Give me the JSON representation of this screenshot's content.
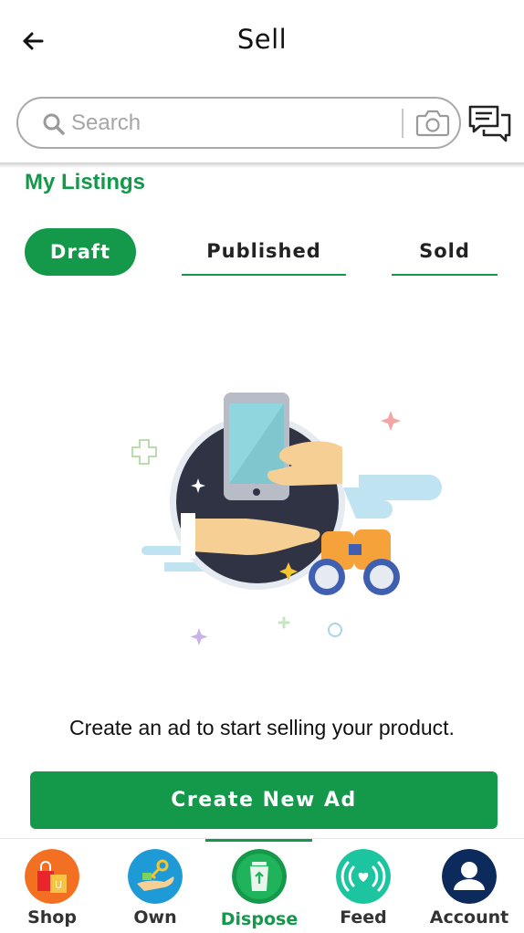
{
  "header": {
    "title": "Sell",
    "back_icon": "arrow-left-icon"
  },
  "search": {
    "placeholder": "Search",
    "value": "",
    "icons": [
      "search-icon",
      "camera-icon",
      "chat-icon"
    ]
  },
  "listings": {
    "title": "My Listings",
    "tabs": [
      {
        "label": "Draft",
        "selected": true
      },
      {
        "label": "Published",
        "selected": false
      },
      {
        "label": "Sold",
        "selected": false
      }
    ]
  },
  "empty_state": {
    "message": "Create an ad to start selling your product."
  },
  "actions": {
    "create_label": "Create New Ad"
  },
  "bottom_nav": {
    "items": [
      {
        "label": "Shop",
        "icon": "shopping-bags-icon",
        "color": "#f36f21"
      },
      {
        "label": "Own",
        "icon": "hand-key-icon",
        "color": "#1e9ad6"
      },
      {
        "label": "Dispose",
        "icon": "recycle-bin-icon",
        "color": "#14984a",
        "active": true
      },
      {
        "label": "Feed",
        "icon": "broadcast-heart-icon",
        "color": "#1cc4a0"
      },
      {
        "label": "Account",
        "icon": "user-icon",
        "color": "#0d2a5c"
      }
    ]
  },
  "colors": {
    "brand_green": "#14984a",
    "text": "#111111",
    "muted": "#a6a6a6"
  }
}
